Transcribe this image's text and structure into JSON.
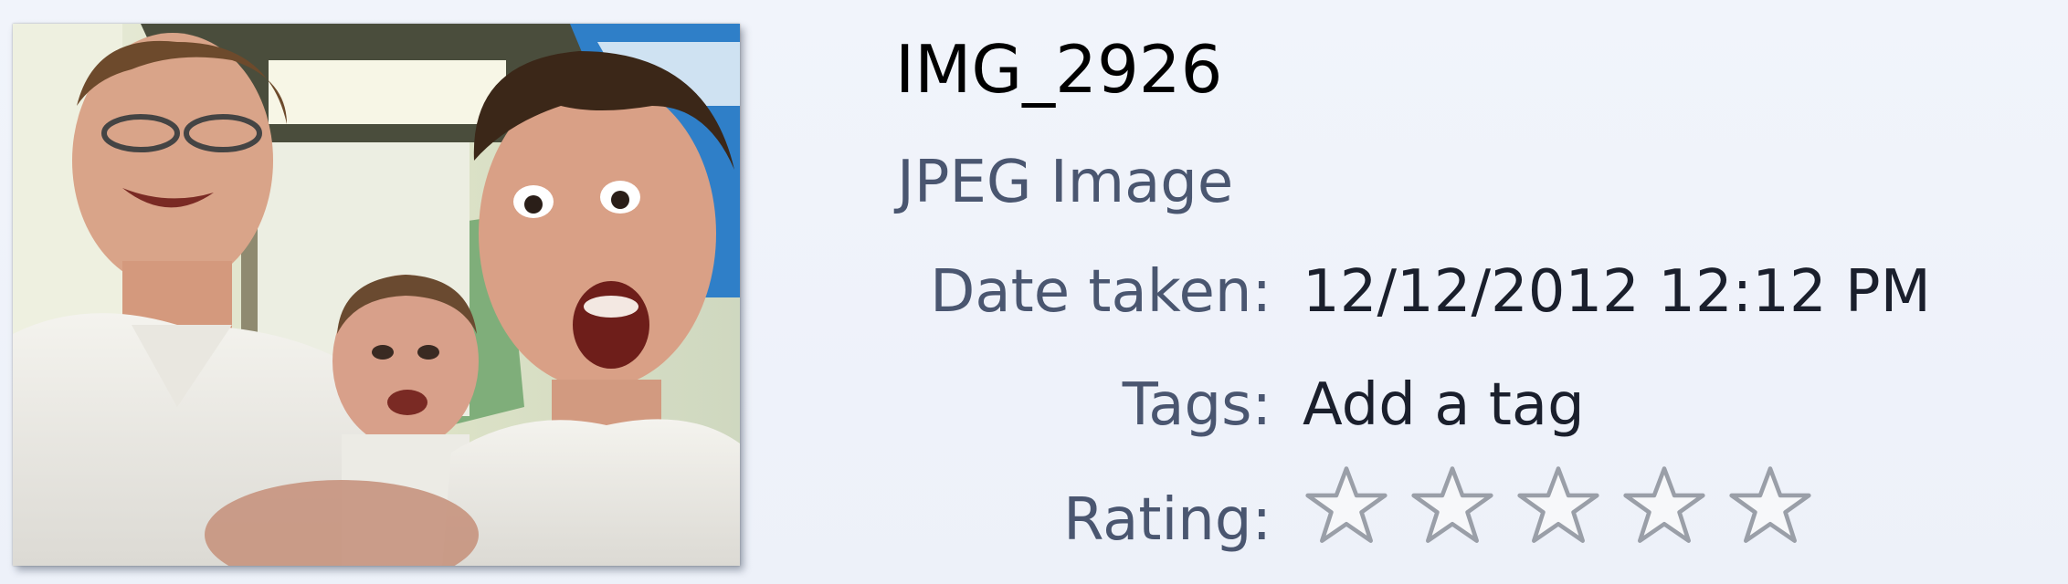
{
  "file": {
    "name": "IMG_2926",
    "type": "JPEG Image"
  },
  "properties": {
    "date_taken_label": "Date taken:",
    "date_taken_value": "12/12/2012 12:12 PM",
    "tags_label": "Tags:",
    "tags_value": "Add a tag",
    "rating_label": "Rating:"
  },
  "rating": {
    "value": 0,
    "max": 5,
    "stars": [
      {
        "icon": "star-empty-icon"
      },
      {
        "icon": "star-empty-icon"
      },
      {
        "icon": "star-empty-icon"
      },
      {
        "icon": "star-empty-icon"
      },
      {
        "icon": "star-empty-icon"
      }
    ]
  },
  "thumbnail": {
    "icon": "photo-thumbnail"
  }
}
